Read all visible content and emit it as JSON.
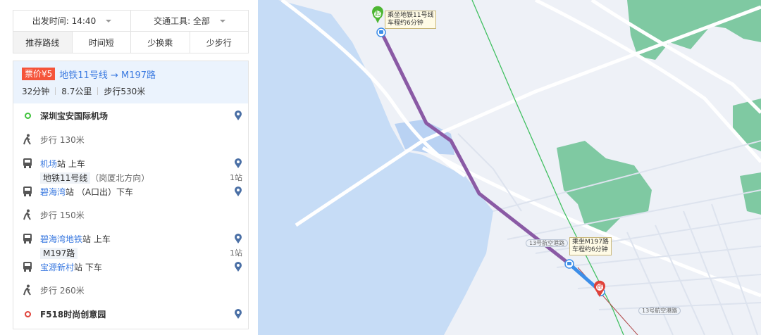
{
  "map": {
    "start_label_line1": "乘坐地铁11号线",
    "start_label_line2": "车程约6分钟",
    "transfer_label_line1": "乘坐M197路",
    "transfer_label_line2": "车程约6分钟",
    "start_marker": "起",
    "end_marker": "终",
    "road_label_1": "13号航空港路",
    "road_label_2": "13号航空港路",
    "colors": {
      "water": "#c6dcf6",
      "land": "#eef1f7",
      "green": "#7fc9a2",
      "metro": "#8a5aa5",
      "bus": "#3d8ee8",
      "railway": "#42c062"
    }
  },
  "filters": {
    "depart_label": "出发时间: 14:40",
    "transport_label": "交通工具: 全部"
  },
  "tabs": [
    {
      "label": "推荐路线",
      "active": true
    },
    {
      "label": "时间短",
      "active": false
    },
    {
      "label": "少换乘",
      "active": false
    },
    {
      "label": "少步行",
      "active": false
    }
  ],
  "route": {
    "fare": "票价¥5",
    "name": "地铁11号线 → M197路",
    "duration": "32分钟",
    "distance": "8.7公里",
    "walk": "步行530米"
  },
  "steps": {
    "origin": "深圳宝安国际机场",
    "walk1": "步行  130米",
    "board1_station": "机场",
    "board1_suffix": "站  上车",
    "line1_name": "地铁11号线",
    "line1_direction": "（岗厦北方向）",
    "line1_stops": "1站",
    "alight1_station": "碧海湾",
    "alight1_suffix": "站  （A口出）下车",
    "walk2": "步行  150米",
    "board2_station": "碧海湾地铁",
    "board2_suffix": "站  上车",
    "line2_name": "M197路",
    "line2_stops": "1站",
    "alight2_station": "宝源新村",
    "alight2_suffix": "站  下车",
    "walk3": "步行  260米",
    "destination": "F518时尚创意园"
  }
}
